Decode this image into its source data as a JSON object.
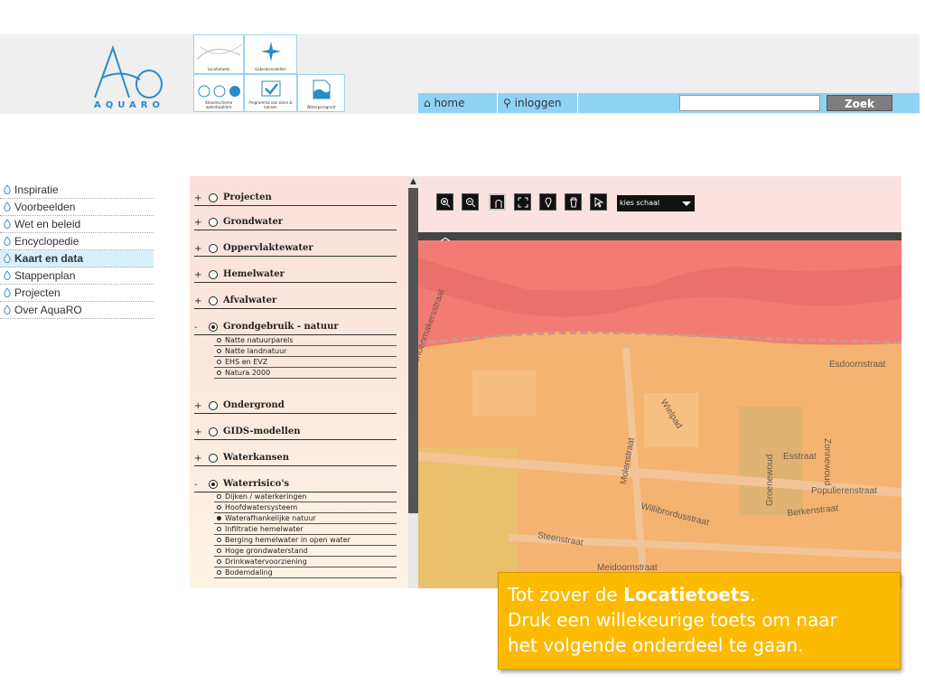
{
  "brand": {
    "logo_text": "AQUARO"
  },
  "tiles": [
    {
      "caption": "Locatietoets"
    },
    {
      "caption": "Gebiedsmodellen"
    },
    {
      "caption": "Stroomschema waterkwaliteit"
    },
    {
      "caption": "Programma van eisen & kansen"
    },
    {
      "caption": "Waterparagraaf"
    }
  ],
  "navbar": {
    "home_label": "home",
    "login_label": "inloggen",
    "search_placeholder": "",
    "search_button": "Zoek"
  },
  "menu": {
    "items": [
      {
        "label": "Inspiratie",
        "active": false
      },
      {
        "label": "Voorbeelden",
        "active": false
      },
      {
        "label": "Wet en beleid",
        "active": false
      },
      {
        "label": "Encyclopedie",
        "active": false
      },
      {
        "label": "Kaart en data",
        "active": true
      },
      {
        "label": "Stappenplan",
        "active": false
      },
      {
        "label": "Projecten",
        "active": false
      },
      {
        "label": "Over AquaRO",
        "active": false
      }
    ]
  },
  "layers": {
    "groups": [
      {
        "sign": "+",
        "label": "Projecten",
        "selected": false
      },
      {
        "sign": "+",
        "label": "Grondwater",
        "selected": false
      },
      {
        "sign": "+",
        "label": "Oppervlaktewater",
        "selected": false
      },
      {
        "sign": "+",
        "label": "Hemelwater",
        "selected": false
      },
      {
        "sign": "+",
        "label": "Afvalwater",
        "selected": false
      },
      {
        "sign": "-",
        "label": "Grondgebruik - natuur",
        "selected": true
      },
      {
        "sign": "+",
        "label": "Ondergrond",
        "selected": false
      },
      {
        "sign": "+",
        "label": "GIDS-modellen",
        "selected": false
      },
      {
        "sign": "+",
        "label": "Waterkansen",
        "selected": false
      },
      {
        "sign": "-",
        "label": "Waterrisico's",
        "selected": true
      }
    ],
    "natuur_items": [
      {
        "label": "Natte natuurparels",
        "selected": false
      },
      {
        "label": "Natte landnatuur",
        "selected": false
      },
      {
        "label": "EHS en EVZ",
        "selected": false
      },
      {
        "label": "Natura 2000",
        "selected": false
      }
    ],
    "risico_items": [
      {
        "label": "Dijken / waterkeringen",
        "selected": false
      },
      {
        "label": "Hoofdwatersysteem",
        "selected": false
      },
      {
        "label": "Waterafhankelijke natuur",
        "selected": true
      },
      {
        "label": "Infiltratie hemelwater",
        "selected": false
      },
      {
        "label": "Berging hemelwater in open water",
        "selected": false
      },
      {
        "label": "Hoge grondwaterstand",
        "selected": false
      },
      {
        "label": "Drinkwatervoorziening",
        "selected": false
      },
      {
        "label": "Bodemdaling",
        "selected": false
      }
    ]
  },
  "map": {
    "toolbar": {
      "tools": [
        "zoom-box-icon",
        "zoom-out-icon",
        "pan-hand-icon",
        "full-extent-icon",
        "marker-icon",
        "trash-icon",
        "select-pointer-icon"
      ],
      "scale_label": "kies schaal"
    },
    "streets": [
      {
        "name": "Schoenmakersstraat"
      },
      {
        "name": "Esdoornstraat"
      },
      {
        "name": "Wielpad"
      },
      {
        "name": "Zonnewoud"
      },
      {
        "name": "Molenstraat"
      },
      {
        "name": "Esstraat"
      },
      {
        "name": "Groenewoud"
      },
      {
        "name": "Populierenstraat"
      },
      {
        "name": "Willibrordusstraat"
      },
      {
        "name": "Berkenstraat"
      },
      {
        "name": "Steenstraat"
      },
      {
        "name": "Meidoornstraat"
      }
    ],
    "colors": {
      "risk_high": "#f27c73",
      "risk_medium": "#f6b77a",
      "water": "#e06a6a"
    }
  },
  "callout": {
    "line1_prefix": "Tot zover de ",
    "line1_bold": "Locatietoets",
    "line1_suffix": ".",
    "line2": "Druk een willekeurige toets om naar",
    "line3": "het volgende onderdeel te gaan."
  }
}
